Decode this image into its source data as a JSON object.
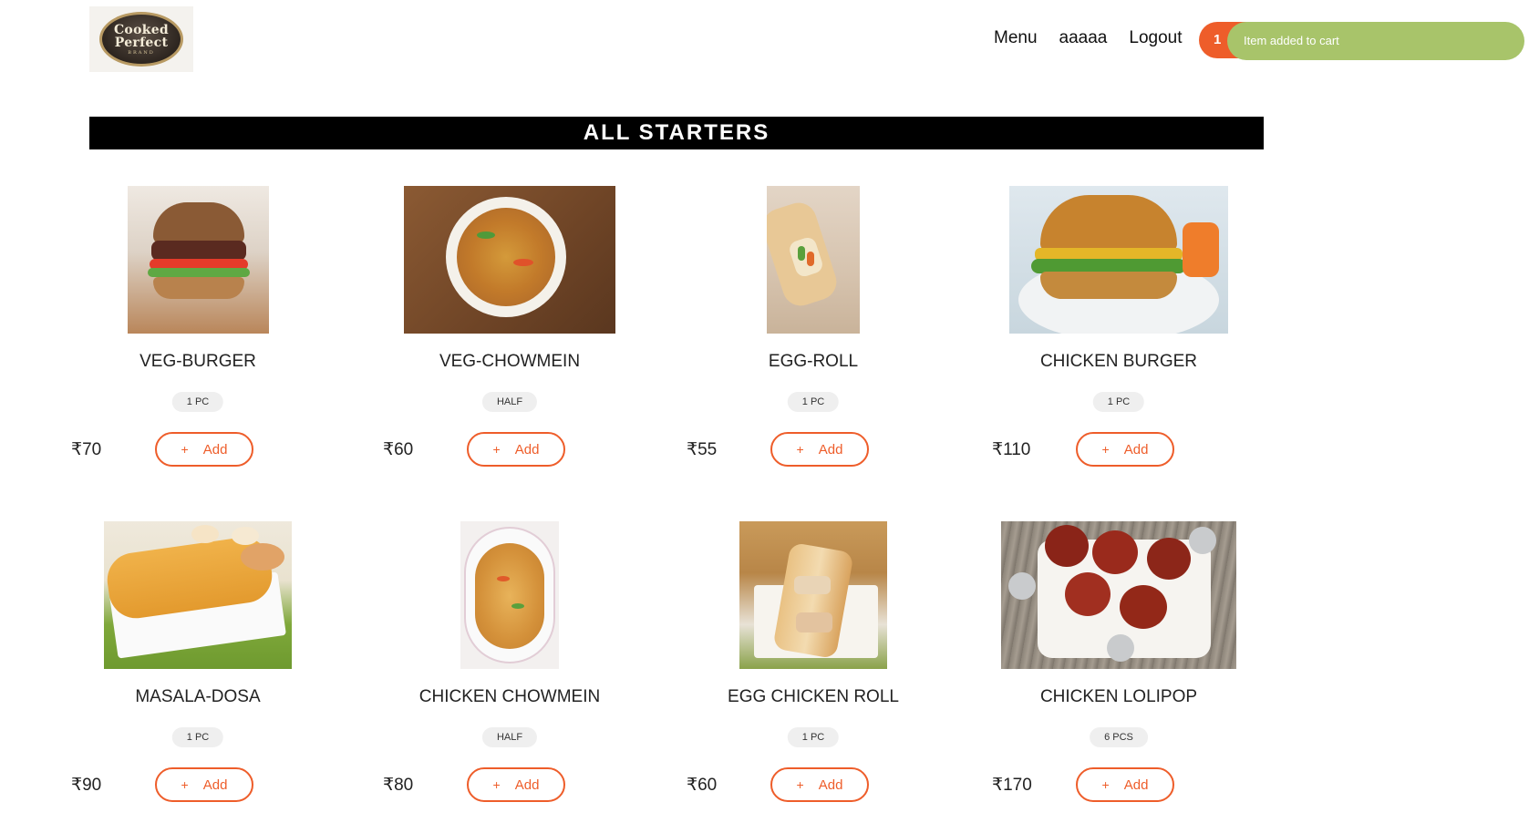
{
  "header": {
    "logo": {
      "line1": "Cooked",
      "line2": "Perfect",
      "line3": "BRAND"
    },
    "nav": [
      {
        "label": "Menu"
      },
      {
        "label": "aaaaa"
      },
      {
        "label": "Logout"
      }
    ],
    "cart_count": "1",
    "toast": "Item added to cart"
  },
  "section": {
    "title": "ALL STARTERS"
  },
  "add_label": "Add",
  "add_symbol": "+",
  "products": [
    {
      "name": "VEG-BURGER",
      "size": "1 PC",
      "price": "₹70"
    },
    {
      "name": "VEG-CHOWMEIN",
      "size": "HALF",
      "price": "₹60"
    },
    {
      "name": "EGG-ROLL",
      "size": "1 PC",
      "price": "₹55"
    },
    {
      "name": "CHICKEN BURGER",
      "size": "1 PC",
      "price": "₹110"
    },
    {
      "name": "MASALA-DOSA",
      "size": "1 PC",
      "price": "₹90"
    },
    {
      "name": "CHICKEN CHOWMEIN",
      "size": "HALF",
      "price": "₹80"
    },
    {
      "name": "EGG CHICKEN ROLL",
      "size": "1 PC",
      "price": "₹60"
    },
    {
      "name": "CHICKEN LOLIPOP",
      "size": "6 PCS",
      "price": "₹170"
    }
  ],
  "colors": {
    "accent": "#ee5d2a",
    "toast": "#a8c46a",
    "title_bar": "#000000"
  }
}
